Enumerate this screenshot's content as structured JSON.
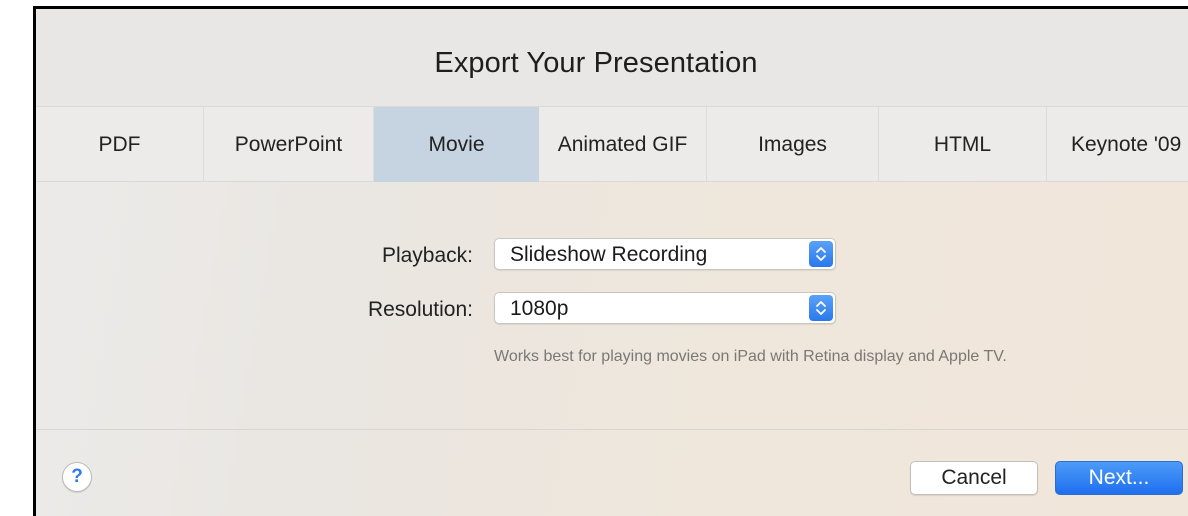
{
  "dialog": {
    "title": "Export Your Presentation"
  },
  "tabs": [
    {
      "label": "PDF"
    },
    {
      "label": "PowerPoint"
    },
    {
      "label": "Movie"
    },
    {
      "label": "Animated GIF"
    },
    {
      "label": "Images"
    },
    {
      "label": "HTML"
    },
    {
      "label": "Keynote '09"
    }
  ],
  "active_tab": "Movie",
  "form": {
    "playback_label": "Playback:",
    "playback_value": "Slideshow Recording",
    "resolution_label": "Resolution:",
    "resolution_value": "1080p",
    "help_text": "Works best for playing movies on iPad with Retina display and Apple TV."
  },
  "footer": {
    "help_symbol": "?",
    "cancel_label": "Cancel",
    "next_label": "Next..."
  },
  "icons": {
    "select_stepper": "up-down-chevron-icon",
    "help": "question-mark-icon"
  },
  "colors": {
    "accent": "#2a78ec",
    "active_tab": "#c6d3e0"
  }
}
